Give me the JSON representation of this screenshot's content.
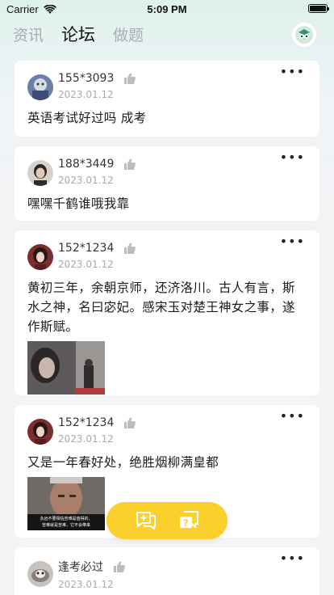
{
  "status_bar": {
    "carrier": "Carrier",
    "time": "5:09 PM"
  },
  "nav": {
    "tabs": [
      {
        "label": "资讯",
        "active": false
      },
      {
        "label": "论坛",
        "active": true
      },
      {
        "label": "做题",
        "active": false
      }
    ],
    "profile_icon": "owl-icon"
  },
  "posts": [
    {
      "user": "155*3093",
      "date": "2023.01.12",
      "text": "英语考试好过吗 成考",
      "has_image": false
    },
    {
      "user": "188*3449",
      "date": "2023.01.12",
      "text": "嘿嘿千鹤谁哦我靠",
      "has_image": false
    },
    {
      "user": "152*1234",
      "date": "2023.01.12",
      "text": "黄初三年，余朝京师，还济洛川。古人有言，斯水之神，名曰宓妃。感宋玉对楚王神女之事，遂作斯赋。",
      "has_image": true
    },
    {
      "user": "152*1234",
      "date": "2023.01.12",
      "text": "又是一年春好处，绝胜烟柳满皇都",
      "has_image": true,
      "image_caption_1": "永远不要相信苦难是值得的，",
      "image_caption_2": "苦难就是苦难，它不会带来"
    },
    {
      "user": "逢考必过",
      "date": "2023.01.12",
      "text": "",
      "has_image": false
    }
  ],
  "fab": {
    "left_icon": "add-post-icon",
    "right_icon": "question-icon",
    "color": "#fbcf2c"
  }
}
